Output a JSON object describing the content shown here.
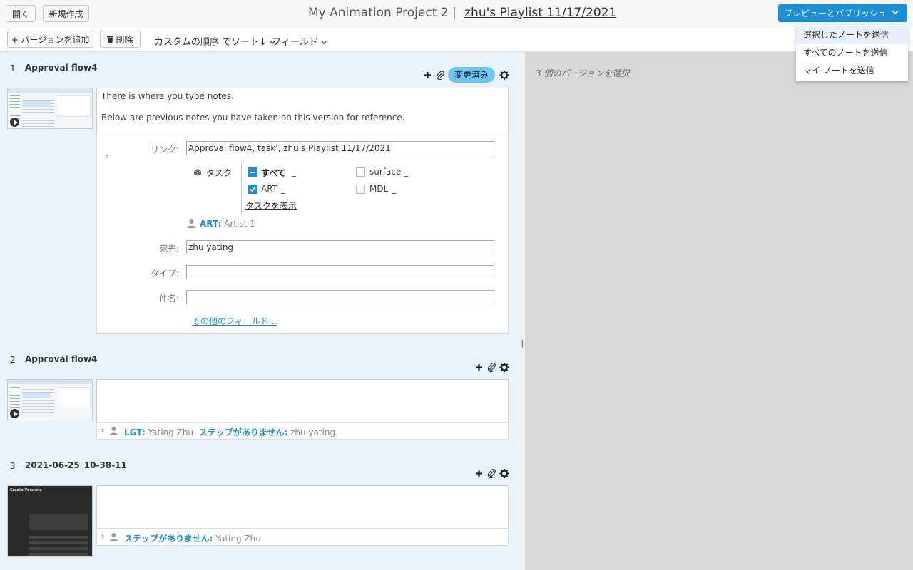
{
  "header": {
    "open_label": "開く",
    "new_label": "新規作成",
    "project_title": "My Animation Project 2 |",
    "playlist_title": "zhu's Playlist 11/17/2021",
    "publish_label": "プレビューとパブリッシュ"
  },
  "toolbar": {
    "add_version_label": "+ バージョンを追加",
    "delete_label": "削除",
    "sort_label": "カスタムの順序 でソート↓",
    "fields_label": "フィールド"
  },
  "publish_menu": {
    "items": [
      "選択したノートを送信",
      "すべてのノートを送信",
      "マイ ノートを送信"
    ]
  },
  "right_panel": {
    "selection_text": "3 個のバージョンを選択"
  },
  "versions": [
    {
      "num": "1",
      "name": "Approval flow4",
      "status_badge": "変更済み",
      "note_line1": "There is where you type notes.",
      "note_line2": "Below are previous notes you have taken on this version for reference.",
      "form": {
        "link_label": "リンク:",
        "link_value": "Approval flow4, task', zhu's Playlist 11/17/2021",
        "task_label": "タスク",
        "tasks": [
          {
            "label": "すべて",
            "state": "partial"
          },
          {
            "label": "surface",
            "state": "unchecked"
          },
          {
            "label": "ART",
            "state": "checked"
          },
          {
            "label": "MDL",
            "state": "unchecked"
          }
        ],
        "show_tasks_link": "タスクを表示",
        "assignee_step": "ART:",
        "assignee_name": "Artist 1",
        "to_label": "宛先:",
        "to_value": "zhu yating",
        "type_label": "タイプ:",
        "type_value": "",
        "subject_label": "件名:",
        "subject_value": "",
        "more_fields_link": "その他のフィールド..."
      }
    },
    {
      "num": "2",
      "name": "Approval flow4",
      "footer_step": "LGT:",
      "footer_user": "Yating Zhu",
      "footer_nostep": "ステップがありません:",
      "footer_user2": "zhu yating"
    },
    {
      "num": "3",
      "name": "2021-06-25_10-38-11",
      "thumb_title": "Create Versions",
      "footer_nostep": "ステップがありません:",
      "footer_user": "Yating Zhu"
    }
  ],
  "colors": {
    "accent": "#1a8ed6",
    "badge": "#6ec6f0",
    "left_panel_bg": "#eaf3fa",
    "right_panel_bg": "#d8d8d8"
  }
}
